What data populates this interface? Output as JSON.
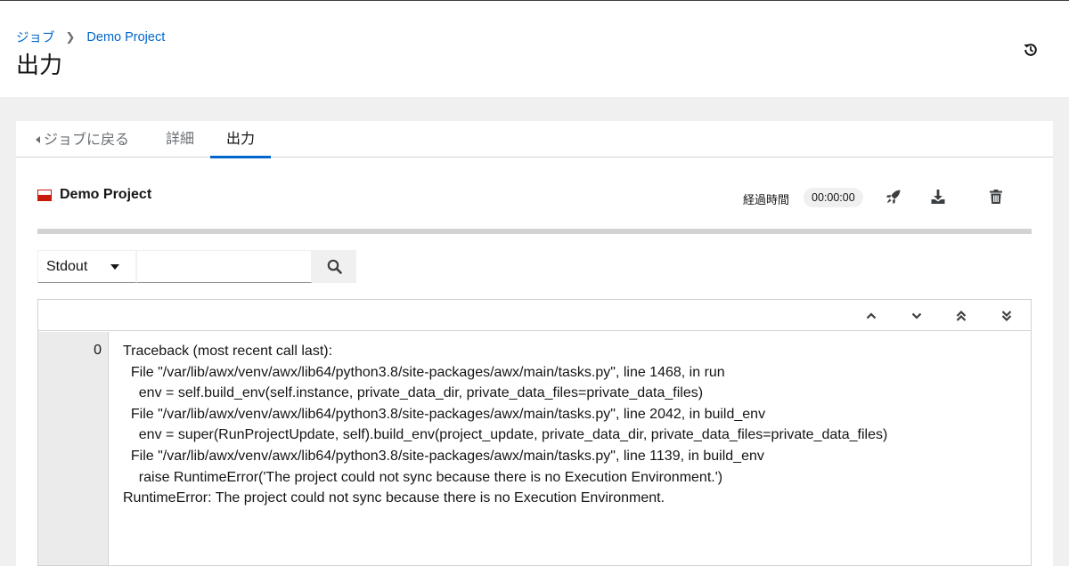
{
  "breadcrumb": {
    "parent_label": "ジョブ",
    "current_label": "Demo Project"
  },
  "page": {
    "title": "出力"
  },
  "header_actions": {
    "history_icon": "history-icon"
  },
  "tabs": [
    {
      "label": "ジョブに戻る",
      "active": false
    },
    {
      "label": "詳細",
      "active": false
    },
    {
      "label": "出力",
      "active": true
    }
  ],
  "job": {
    "name": "Demo Project",
    "status": "failed",
    "status_color": "#c9190b",
    "elapsed_label": "経過時間",
    "elapsed_value": "00:00:00",
    "actions": [
      "rocket-icon",
      "download-icon",
      "trash-icon"
    ]
  },
  "filter": {
    "selected_option": "Stdout",
    "search_value": "",
    "search_icon": "search-icon"
  },
  "log_navigation": [
    "angle-up-icon",
    "angle-down-icon",
    "angle-double-up-icon",
    "angle-double-down-icon"
  ],
  "log": {
    "line_number": "0",
    "lines": [
      "Traceback (most recent call last):",
      "  File \"/var/lib/awx/venv/awx/lib64/python3.8/site-packages/awx/main/tasks.py\", line 1468, in run",
      "    env = self.build_env(self.instance, private_data_dir, private_data_files=private_data_files)",
      "  File \"/var/lib/awx/venv/awx/lib64/python3.8/site-packages/awx/main/tasks.py\", line 2042, in build_env",
      "    env = super(RunProjectUpdate, self).build_env(project_update, private_data_dir, private_data_files=private_data_files)",
      "  File \"/var/lib/awx/venv/awx/lib64/python3.8/site-packages/awx/main/tasks.py\", line 1139, in build_env",
      "    raise RuntimeError('The project could not sync because there is no Execution Environment.')",
      "RuntimeError: The project could not sync because there is no Execution Environment."
    ]
  },
  "colors": {
    "accent": "#0066cc",
    "failed": "#c9190b",
    "page_background": "#f0f0f0"
  }
}
